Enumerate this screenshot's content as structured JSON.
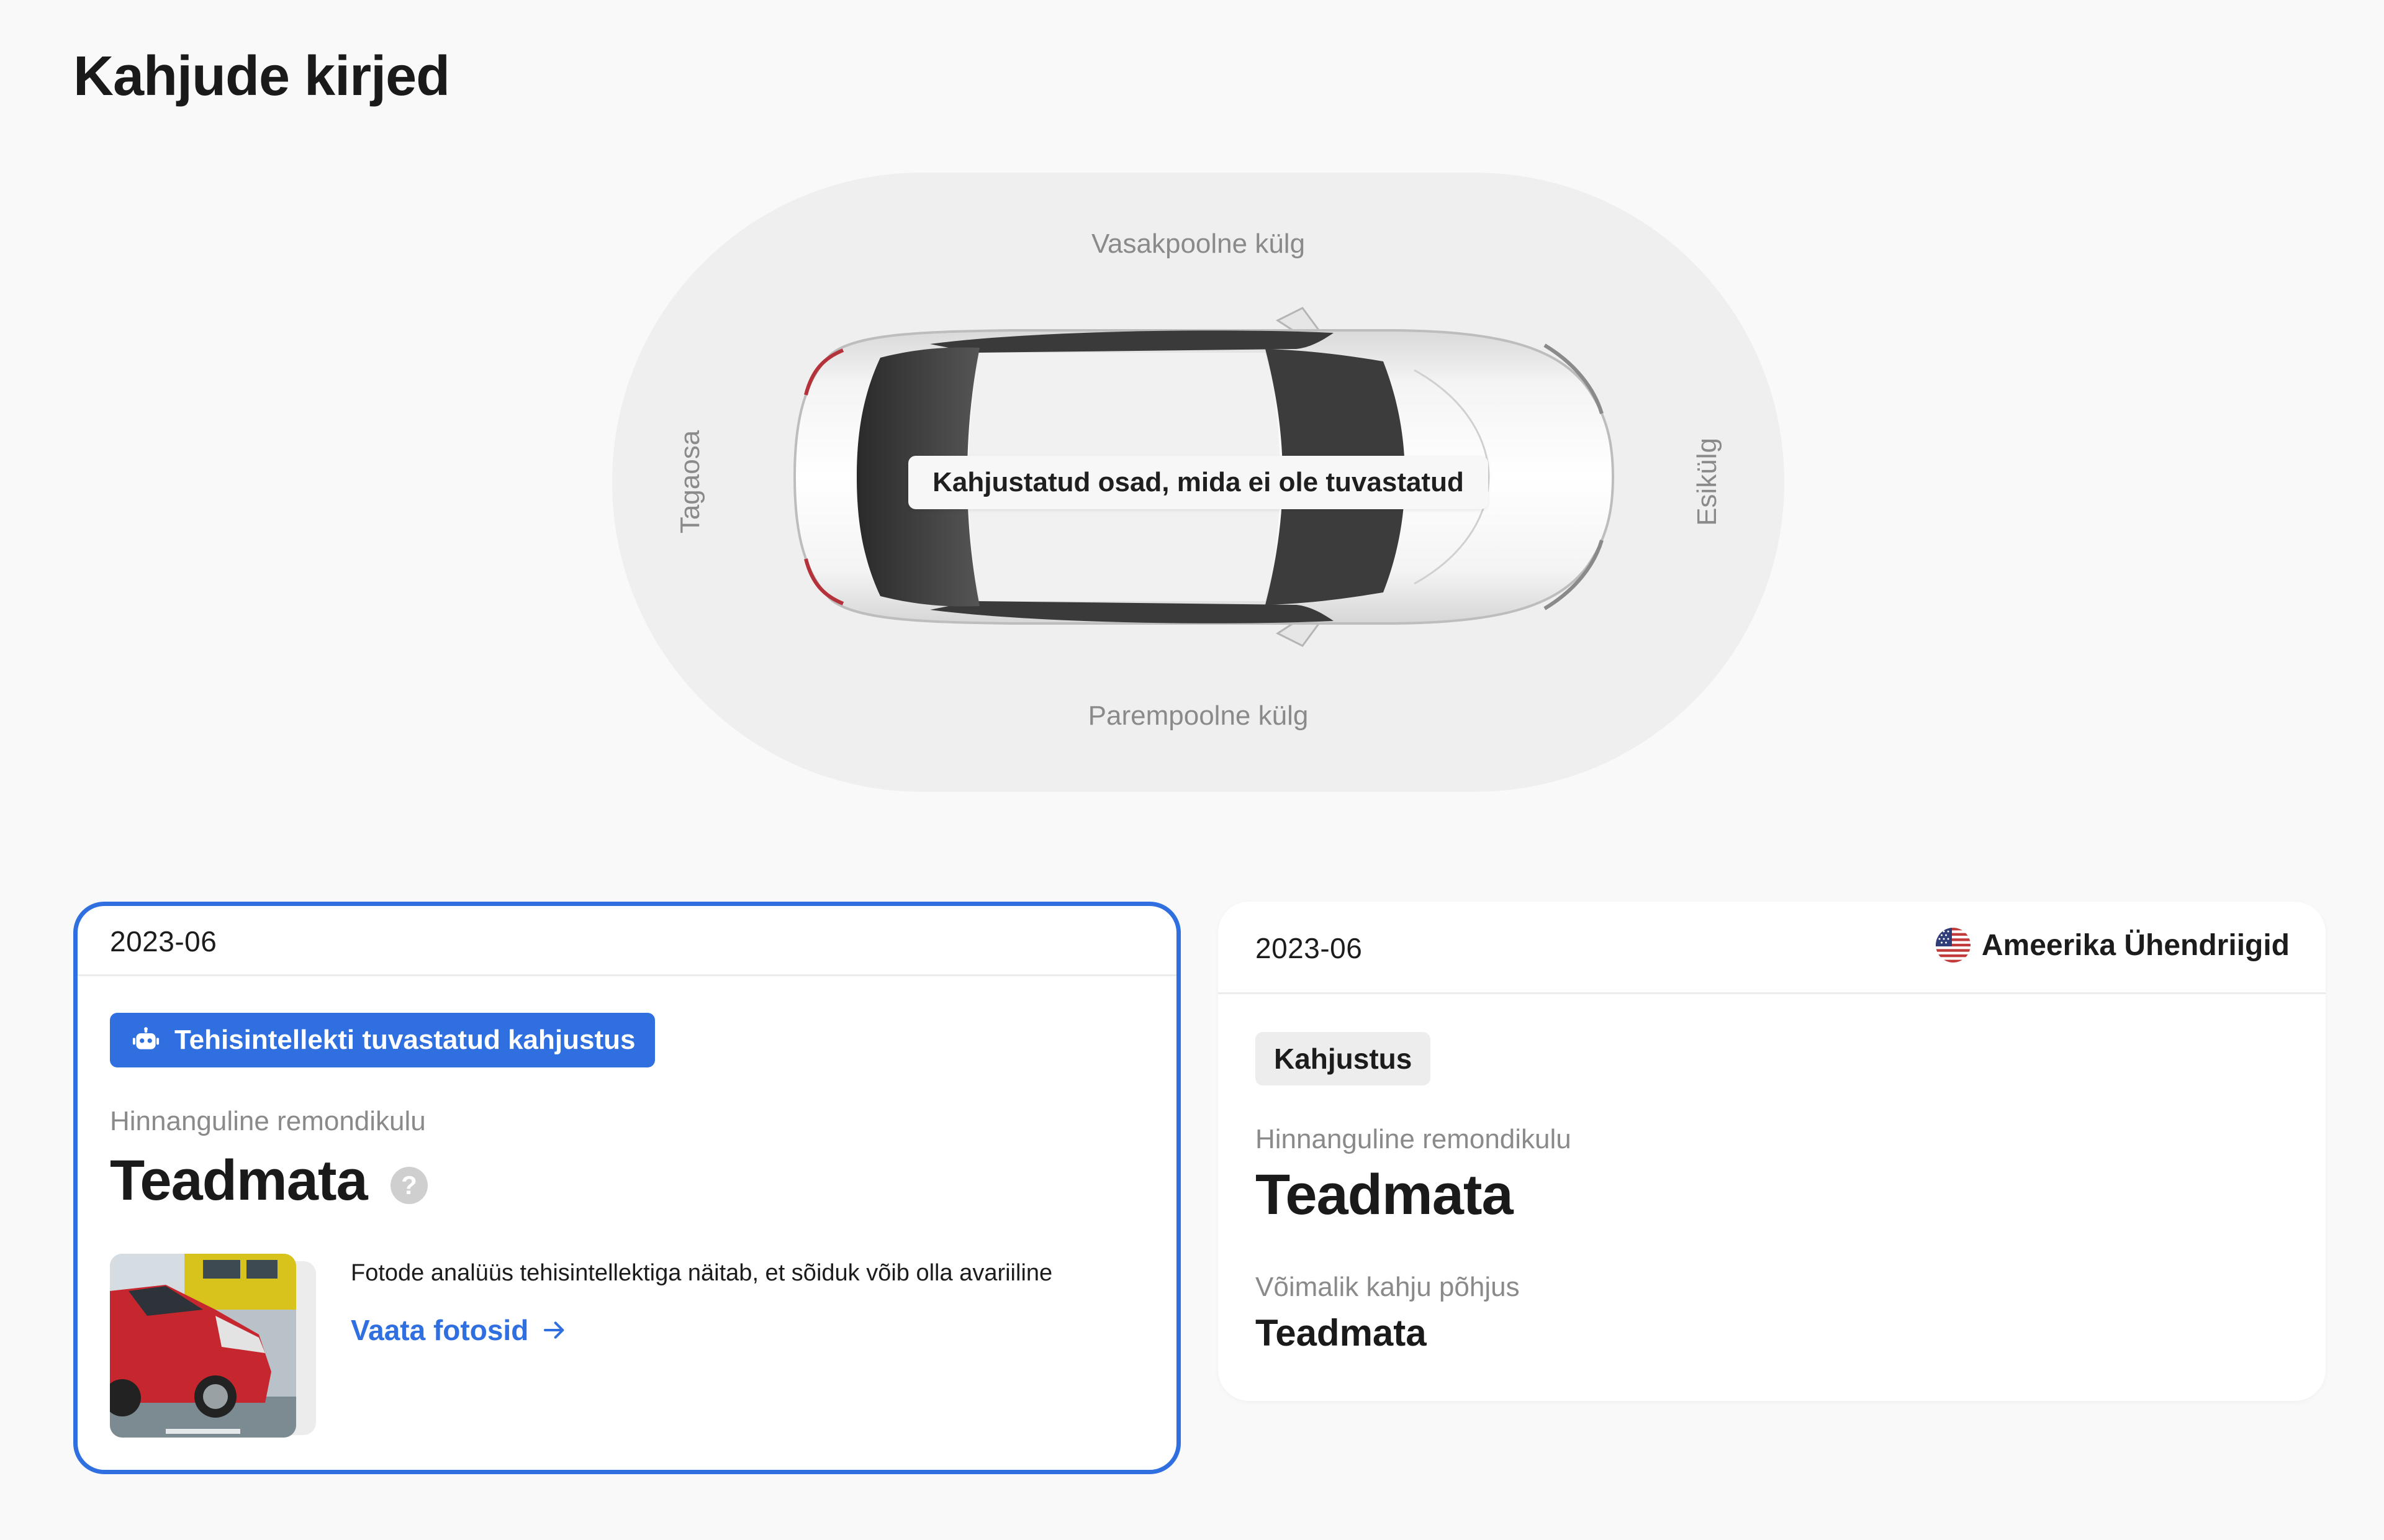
{
  "page": {
    "title": "Kahjude kirjed"
  },
  "diagram": {
    "left_side": "Vasakpoolne külg",
    "right_side": "Parempoolne külg",
    "rear": "Tagaosa",
    "front": "Esikülg",
    "status": "Kahjustatud osad, mida ei ole tuvastatud"
  },
  "records": [
    {
      "date": "2023-06",
      "badge": "Tehisintellekti tuvastatud kahjustus",
      "badge_icon": "robot-icon",
      "cost_label": "Hinnanguline remondikulu",
      "cost_value": "Teadmata",
      "help_icon": "question-icon",
      "photo_text": "Fotode analüüs tehisintellektiga näitab, et sõiduk võib olla avariiline",
      "photo_link": "Vaata fotosid"
    },
    {
      "date": "2023-06",
      "country": "Ameerika Ühendriigid",
      "country_icon": "us-flag-icon",
      "badge": "Kahjustus",
      "cost_label": "Hinnanguline remondikulu",
      "cost_value": "Teadmata",
      "cause_label": "Võimalik kahju põhjus",
      "cause_value": "Teadmata"
    }
  ],
  "colors": {
    "accent": "#2f6fe0",
    "background": "#f9f9f9",
    "muted": "#8a8a8a"
  }
}
